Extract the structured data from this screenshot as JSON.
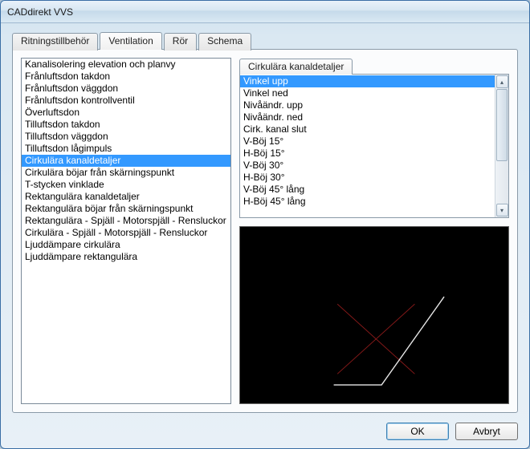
{
  "window": {
    "title": "CADdirekt VVS"
  },
  "tabs": [
    {
      "label": "Ritningstillbehör"
    },
    {
      "label": "Ventilation"
    },
    {
      "label": "Rör"
    },
    {
      "label": "Schema"
    }
  ],
  "active_tab_index": 1,
  "left_list": {
    "selected_index": 8,
    "items": [
      "Kanalisolering elevation och planvy",
      "Frånluftsdon takdon",
      "Frånluftsdon väggdon",
      "Frånluftsdon kontrollventil",
      "Överluftsdon",
      "Tilluftsdon takdon",
      "Tilluftsdon väggdon",
      "Tilluftsdon lågimpuls",
      "Cirkulära kanaldetaljer",
      "Cirkulära böjar från skärningspunkt",
      "T-stycken vinklade",
      "Rektangulära kanaldetaljer",
      "Rektangulära böjar från skärningspunkt",
      "Rektangulära - Spjäll - Motorspjäll - Rensluckor",
      "Cirkulära - Spjäll - Motorspjäll - Rensluckor",
      "Ljuddämpare cirkulära",
      "Ljuddämpare rektangulära"
    ]
  },
  "details": {
    "tab_label": "Cirkulära kanaldetaljer",
    "selected_index": 0,
    "items": [
      "Vinkel upp",
      "Vinkel ned",
      "Nivåändr. upp",
      "Nivåändr. ned",
      "Cirk. kanal slut",
      "V-Böj 15°",
      "H-Böj 15°",
      "V-Böj 30°",
      "H-Böj 30°",
      "V-Böj 45° lång",
      "H-Böj 45° lång"
    ]
  },
  "buttons": {
    "ok": "OK",
    "cancel": "Avbryt"
  },
  "preview": {
    "bg": "#000000",
    "white": "#e8e8e8",
    "red": "#8b1a1a"
  }
}
